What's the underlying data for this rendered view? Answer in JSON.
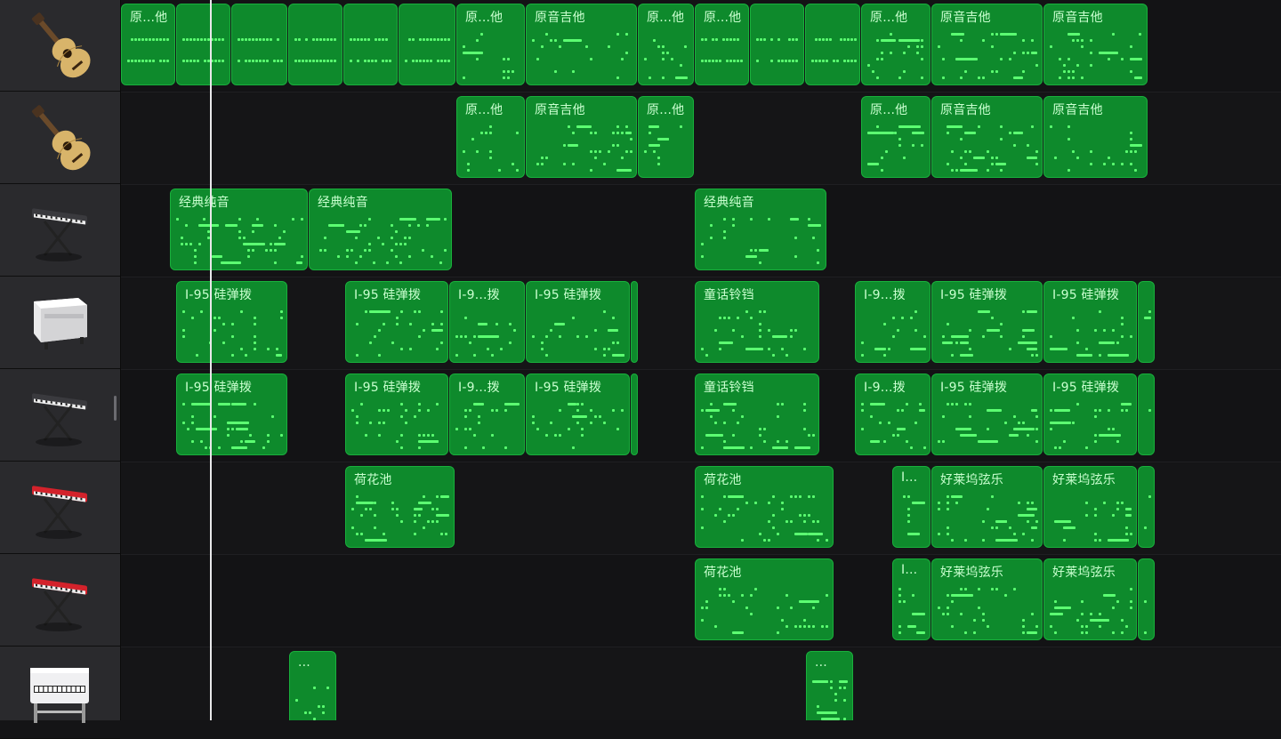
{
  "app": {
    "view": "tracks-view"
  },
  "colors": {
    "region_fill": "#0e8a2c",
    "region_border": "#19b03c",
    "note": "#5cff72",
    "region_text": "#c9ffcf",
    "background": "#141416",
    "header_bg": "#2a2a2d",
    "playhead": "#e8e8ea"
  },
  "tracks": [
    {
      "instrument": "acoustic-guitar-icon",
      "regions": [
        {
          "name": "原...他",
          "start": 0,
          "end": 62,
          "style": "strum"
        },
        {
          "name": "",
          "start": 62,
          "end": 124,
          "style": "strum"
        },
        {
          "name": "",
          "start": 124,
          "end": 188,
          "style": "strum"
        },
        {
          "name": "",
          "start": 188,
          "end": 250,
          "style": "strum"
        },
        {
          "name": "",
          "start": 250,
          "end": 312,
          "style": "strum"
        },
        {
          "name": "",
          "start": 312,
          "end": 377,
          "style": "strum"
        },
        {
          "name": "原...他",
          "start": 377,
          "end": 455
        },
        {
          "name": "原音吉他",
          "start": 455,
          "end": 581
        },
        {
          "name": "原...他",
          "start": 581,
          "end": 645
        },
        {
          "name": "原...他",
          "start": 645,
          "end": 707,
          "style": "strum"
        },
        {
          "name": "",
          "start": 707,
          "end": 769,
          "style": "strum"
        },
        {
          "name": "",
          "start": 769,
          "end": 832,
          "style": "strum"
        },
        {
          "name": "原...他",
          "start": 832,
          "end": 911
        },
        {
          "name": "原音吉他",
          "start": 911,
          "end": 1037
        },
        {
          "name": "原音吉他",
          "start": 1037,
          "end": 1155
        }
      ]
    },
    {
      "instrument": "acoustic-guitar-icon",
      "regions": [
        {
          "name": "原...他",
          "start": 377,
          "end": 455
        },
        {
          "name": "原音吉他",
          "start": 455,
          "end": 581
        },
        {
          "name": "原...他",
          "start": 581,
          "end": 645
        },
        {
          "name": "原...他",
          "start": 832,
          "end": 911
        },
        {
          "name": "原音吉他",
          "start": 911,
          "end": 1037
        },
        {
          "name": "原音吉他",
          "start": 1037,
          "end": 1155
        }
      ]
    },
    {
      "instrument": "synth-keyboard-icon",
      "regions": [
        {
          "name": "经典纯音",
          "start": 55,
          "end": 211
        },
        {
          "name": "经典纯音",
          "start": 211,
          "end": 373
        },
        {
          "name": "经典纯音",
          "start": 645,
          "end": 794
        }
      ]
    },
    {
      "instrument": "electric-piano-icon",
      "regions": [
        {
          "name": "I-95 硅弹拨",
          "start": 62,
          "end": 188
        },
        {
          "name": "I-95 硅弹拨",
          "start": 252,
          "end": 369
        },
        {
          "name": "I-9...拨",
          "start": 369,
          "end": 455
        },
        {
          "name": "I-95 硅弹拨",
          "start": 455,
          "end": 573
        },
        {
          "name": "",
          "start": 573,
          "end": 582
        },
        {
          "name": "童话铃铛",
          "start": 645,
          "end": 786
        },
        {
          "name": "I-9...拨",
          "start": 825,
          "end": 911
        },
        {
          "name": "I-95 硅弹拨",
          "start": 911,
          "end": 1037
        },
        {
          "name": "I-95 硅弹拨",
          "start": 1037,
          "end": 1143
        },
        {
          "name": "",
          "start": 1143,
          "end": 1163
        }
      ]
    },
    {
      "instrument": "synth-keyboard-icon",
      "regions": [
        {
          "name": "I-95 硅弹拨",
          "start": 62,
          "end": 188
        },
        {
          "name": "I-95 硅弹拨",
          "start": 252,
          "end": 369
        },
        {
          "name": "I-9...拨",
          "start": 369,
          "end": 455
        },
        {
          "name": "I-95 硅弹拨",
          "start": 455,
          "end": 573
        },
        {
          "name": "",
          "start": 573,
          "end": 582
        },
        {
          "name": "童话铃铛",
          "start": 645,
          "end": 786
        },
        {
          "name": "I-9...拨",
          "start": 825,
          "end": 911
        },
        {
          "name": "I-95 硅弹拨",
          "start": 911,
          "end": 1037
        },
        {
          "name": "I-95 硅弹拨",
          "start": 1037,
          "end": 1143
        },
        {
          "name": "",
          "start": 1143,
          "end": 1163
        }
      ]
    },
    {
      "instrument": "red-synth-keyboard-icon",
      "regions": [
        {
          "name": "荷花池",
          "start": 252,
          "end": 376
        },
        {
          "name": "荷花池",
          "start": 645,
          "end": 802
        },
        {
          "name": "I...",
          "start": 867,
          "end": 911
        },
        {
          "name": "好莱坞弦乐",
          "start": 911,
          "end": 1037
        },
        {
          "name": "好莱坞弦乐",
          "start": 1037,
          "end": 1143
        },
        {
          "name": "",
          "start": 1143,
          "end": 1163
        }
      ]
    },
    {
      "instrument": "red-synth-keyboard-icon",
      "regions": [
        {
          "name": "荷花池",
          "start": 645,
          "end": 802
        },
        {
          "name": "I...",
          "start": 867,
          "end": 911
        },
        {
          "name": "好莱坞弦乐",
          "start": 911,
          "end": 1037
        },
        {
          "name": "好莱坞弦乐",
          "start": 1037,
          "end": 1143
        },
        {
          "name": "",
          "start": 1143,
          "end": 1163
        }
      ]
    },
    {
      "instrument": "upright-piano-icon",
      "regions": [
        {
          "name": "...",
          "start": 189,
          "end": 243
        },
        {
          "name": "...",
          "start": 770,
          "end": 824
        }
      ]
    }
  ]
}
